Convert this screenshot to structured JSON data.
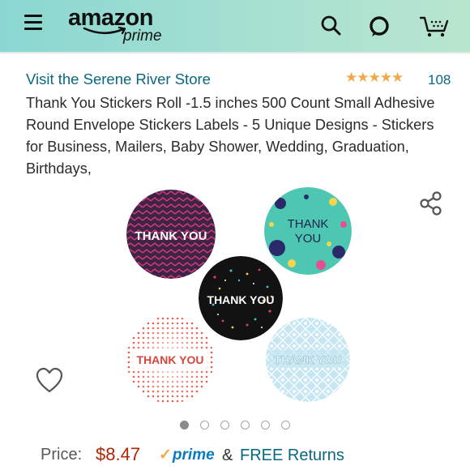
{
  "header": {
    "logo_text": "amazon",
    "logo_subtext": "prime",
    "background_colors": [
      "#8ad7d2",
      "#b9e6cf"
    ],
    "icons": [
      "menu-icon",
      "search-icon",
      "alexa-icon",
      "cart-icon"
    ]
  },
  "product": {
    "store_link": "Visit the Serene River Store",
    "rating_stars": "★★★★★",
    "rating_count": "108",
    "title": "Thank You Stickers Roll -1.5 inches 500 Count Small Adhesive Round Envelope Stickers Labels - 5 Unique Designs - Stickers for Business, Mailers, Baby Shower, Wedding, Graduation, Birthdays,",
    "stickers": [
      {
        "text": "THANK YOU",
        "style": "pink-chevron-on-purple"
      },
      {
        "text": "THANK YOU",
        "style": "teal-with-dots"
      },
      {
        "text": "THANK YOU",
        "style": "black-confetti"
      },
      {
        "text": "THANK YOU",
        "style": "red-halftone"
      },
      {
        "text": "THANK YOU",
        "style": "light-blue-geometric"
      }
    ]
  },
  "gallery": {
    "dot_count": 6,
    "active_index": 0
  },
  "pricing": {
    "label": "Price:",
    "value": "$8.47",
    "prime_check": "✓",
    "prime_text": "prime",
    "ampersand": "&",
    "free_returns": "FREE Returns"
  },
  "colors": {
    "link": "#0a6780",
    "price": "#b12704",
    "star": "#f3a847",
    "prime": "#0a7ac0"
  }
}
